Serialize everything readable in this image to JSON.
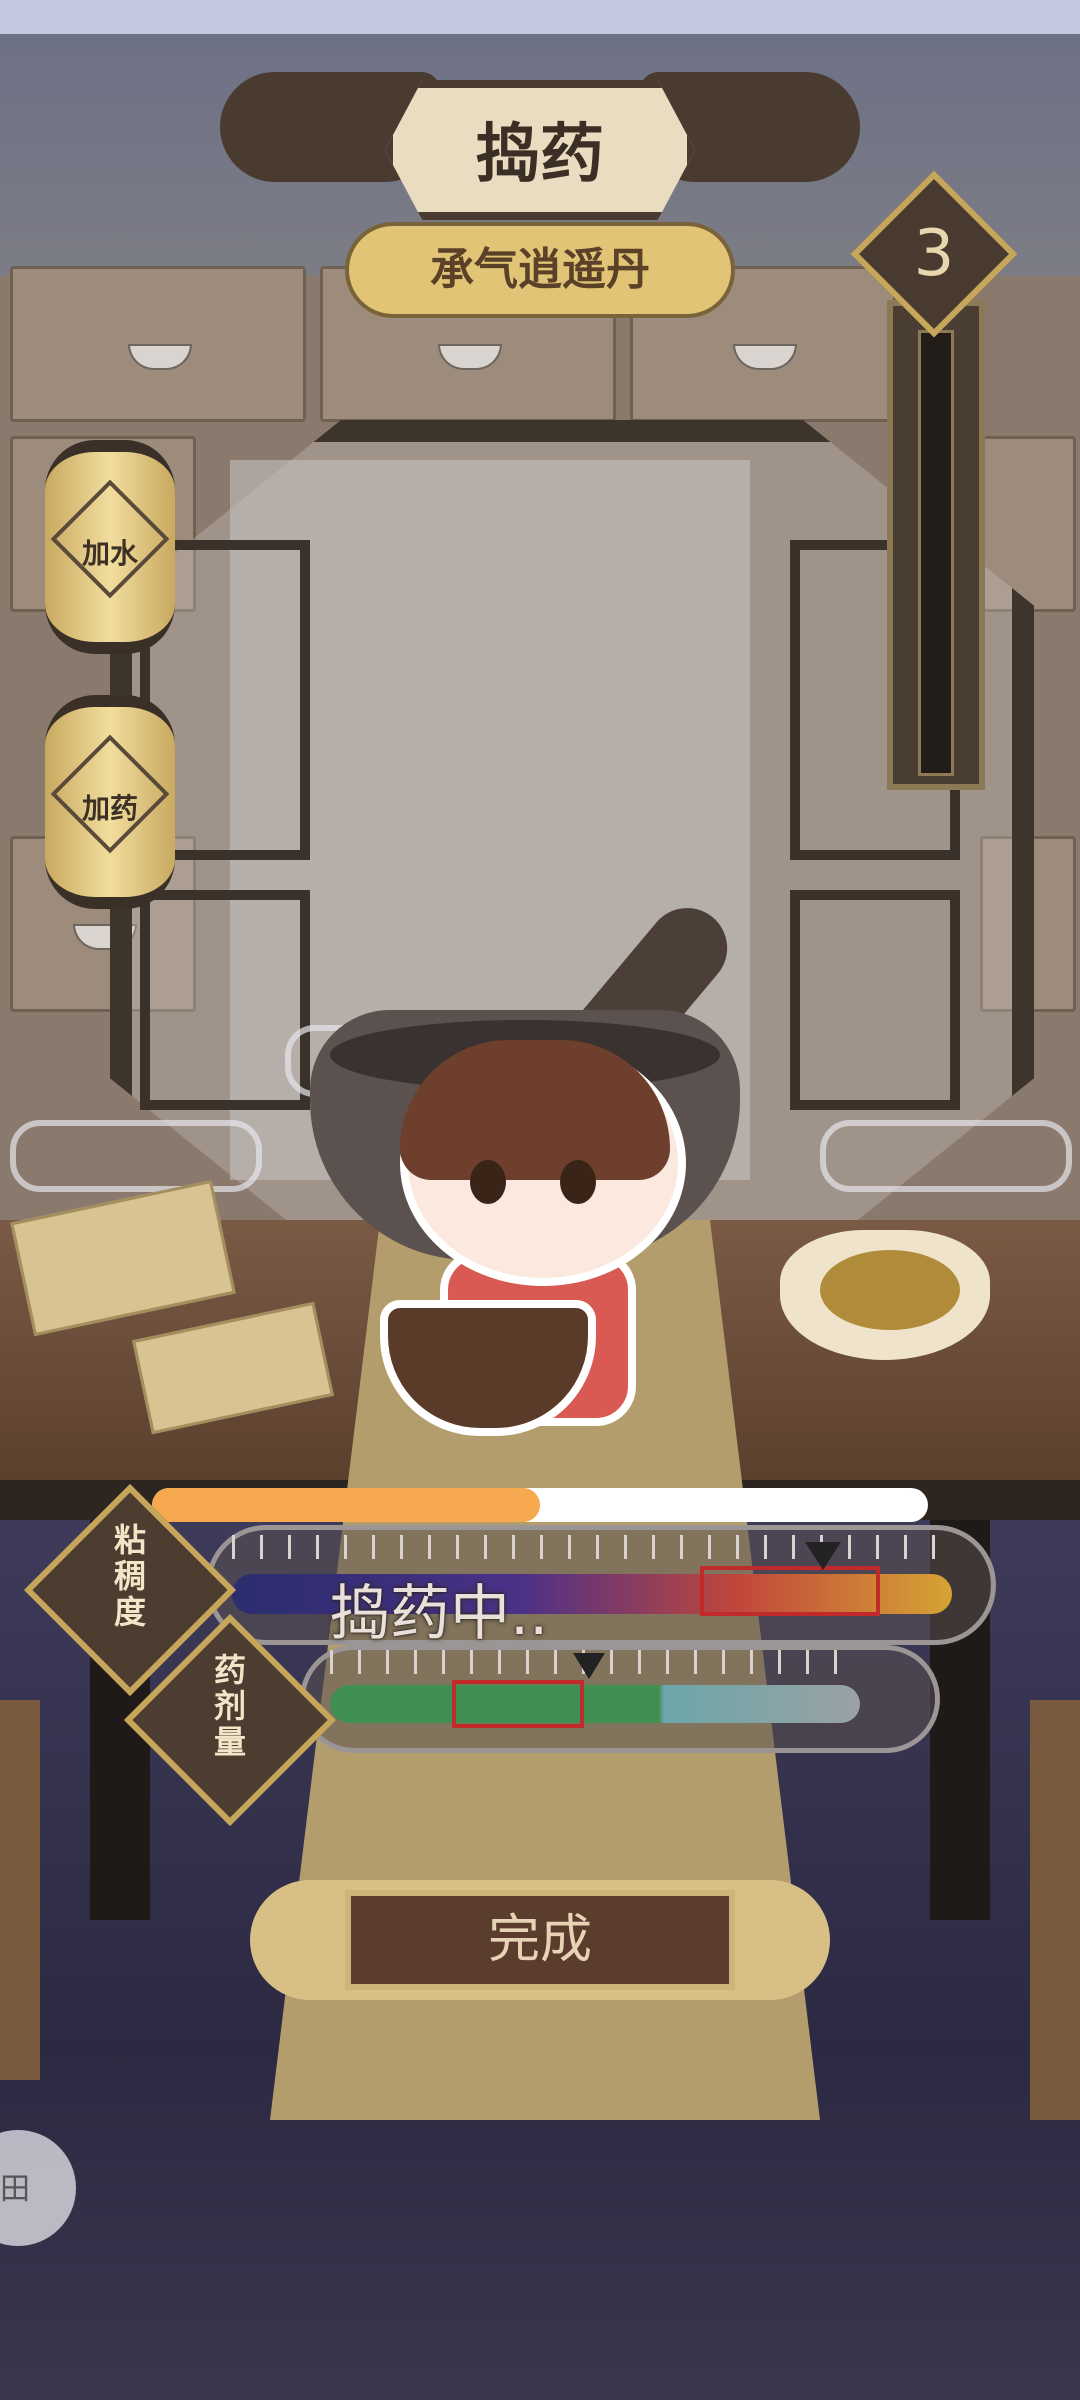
{
  "header": {
    "title": "捣药",
    "recipe_name": "承气逍遥丹"
  },
  "level": {
    "value": "3"
  },
  "side_buttons": {
    "add_water": "加水",
    "add_medicine": "加药"
  },
  "progress": {
    "fraction": 0.5
  },
  "viscosity": {
    "label_chars": [
      "粘",
      "稠",
      "度"
    ],
    "marker_fraction": 0.82,
    "target_range": [
      0.65,
      0.9
    ]
  },
  "dosage": {
    "label_chars": [
      "药",
      "剂",
      "量"
    ],
    "marker_fraction": 0.49,
    "target_range": [
      0.23,
      0.48
    ]
  },
  "status": {
    "text": "捣药中.."
  },
  "complete_button": {
    "label": "完成"
  },
  "floating_button": {
    "glyph": "田"
  },
  "colors": {
    "progress_fill": "#f6a94e",
    "target_zone": "#c12a2a",
    "accent_gold": "#c6a65a",
    "plaque_brown": "#4a3b30"
  },
  "icons": {
    "level_badge": "diamond-badge-icon",
    "lantern": "lantern-icon",
    "floating": "assistive-touch-icon"
  }
}
